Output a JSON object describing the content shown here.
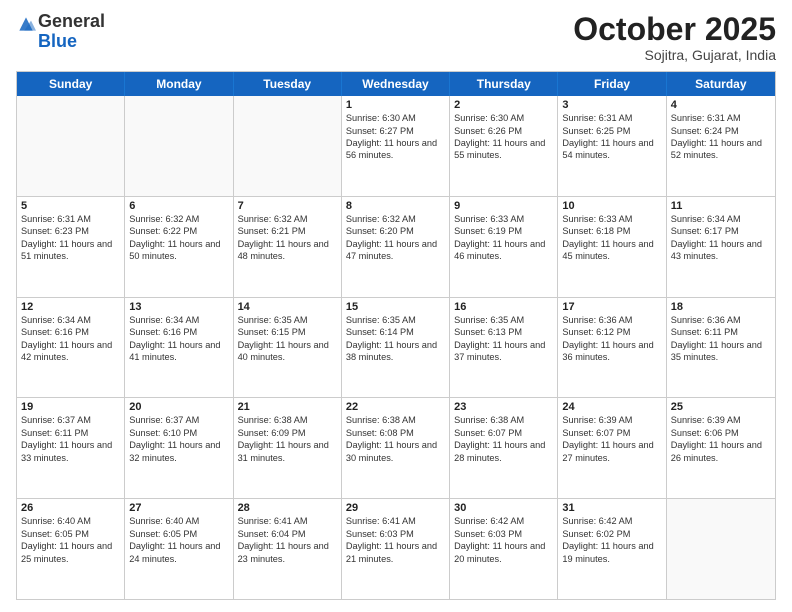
{
  "header": {
    "logo_general": "General",
    "logo_blue": "Blue",
    "month": "October 2025",
    "location": "Sojitra, Gujarat, India"
  },
  "weekdays": [
    "Sunday",
    "Monday",
    "Tuesday",
    "Wednesday",
    "Thursday",
    "Friday",
    "Saturday"
  ],
  "weeks": [
    [
      {
        "day": "",
        "sunrise": "",
        "sunset": "",
        "daylight": ""
      },
      {
        "day": "",
        "sunrise": "",
        "sunset": "",
        "daylight": ""
      },
      {
        "day": "",
        "sunrise": "",
        "sunset": "",
        "daylight": ""
      },
      {
        "day": "1",
        "sunrise": "Sunrise: 6:30 AM",
        "sunset": "Sunset: 6:27 PM",
        "daylight": "Daylight: 11 hours and 56 minutes."
      },
      {
        "day": "2",
        "sunrise": "Sunrise: 6:30 AM",
        "sunset": "Sunset: 6:26 PM",
        "daylight": "Daylight: 11 hours and 55 minutes."
      },
      {
        "day": "3",
        "sunrise": "Sunrise: 6:31 AM",
        "sunset": "Sunset: 6:25 PM",
        "daylight": "Daylight: 11 hours and 54 minutes."
      },
      {
        "day": "4",
        "sunrise": "Sunrise: 6:31 AM",
        "sunset": "Sunset: 6:24 PM",
        "daylight": "Daylight: 11 hours and 52 minutes."
      }
    ],
    [
      {
        "day": "5",
        "sunrise": "Sunrise: 6:31 AM",
        "sunset": "Sunset: 6:23 PM",
        "daylight": "Daylight: 11 hours and 51 minutes."
      },
      {
        "day": "6",
        "sunrise": "Sunrise: 6:32 AM",
        "sunset": "Sunset: 6:22 PM",
        "daylight": "Daylight: 11 hours and 50 minutes."
      },
      {
        "day": "7",
        "sunrise": "Sunrise: 6:32 AM",
        "sunset": "Sunset: 6:21 PM",
        "daylight": "Daylight: 11 hours and 48 minutes."
      },
      {
        "day": "8",
        "sunrise": "Sunrise: 6:32 AM",
        "sunset": "Sunset: 6:20 PM",
        "daylight": "Daylight: 11 hours and 47 minutes."
      },
      {
        "day": "9",
        "sunrise": "Sunrise: 6:33 AM",
        "sunset": "Sunset: 6:19 PM",
        "daylight": "Daylight: 11 hours and 46 minutes."
      },
      {
        "day": "10",
        "sunrise": "Sunrise: 6:33 AM",
        "sunset": "Sunset: 6:18 PM",
        "daylight": "Daylight: 11 hours and 45 minutes."
      },
      {
        "day": "11",
        "sunrise": "Sunrise: 6:34 AM",
        "sunset": "Sunset: 6:17 PM",
        "daylight": "Daylight: 11 hours and 43 minutes."
      }
    ],
    [
      {
        "day": "12",
        "sunrise": "Sunrise: 6:34 AM",
        "sunset": "Sunset: 6:16 PM",
        "daylight": "Daylight: 11 hours and 42 minutes."
      },
      {
        "day": "13",
        "sunrise": "Sunrise: 6:34 AM",
        "sunset": "Sunset: 6:16 PM",
        "daylight": "Daylight: 11 hours and 41 minutes."
      },
      {
        "day": "14",
        "sunrise": "Sunrise: 6:35 AM",
        "sunset": "Sunset: 6:15 PM",
        "daylight": "Daylight: 11 hours and 40 minutes."
      },
      {
        "day": "15",
        "sunrise": "Sunrise: 6:35 AM",
        "sunset": "Sunset: 6:14 PM",
        "daylight": "Daylight: 11 hours and 38 minutes."
      },
      {
        "day": "16",
        "sunrise": "Sunrise: 6:35 AM",
        "sunset": "Sunset: 6:13 PM",
        "daylight": "Daylight: 11 hours and 37 minutes."
      },
      {
        "day": "17",
        "sunrise": "Sunrise: 6:36 AM",
        "sunset": "Sunset: 6:12 PM",
        "daylight": "Daylight: 11 hours and 36 minutes."
      },
      {
        "day": "18",
        "sunrise": "Sunrise: 6:36 AM",
        "sunset": "Sunset: 6:11 PM",
        "daylight": "Daylight: 11 hours and 35 minutes."
      }
    ],
    [
      {
        "day": "19",
        "sunrise": "Sunrise: 6:37 AM",
        "sunset": "Sunset: 6:11 PM",
        "daylight": "Daylight: 11 hours and 33 minutes."
      },
      {
        "day": "20",
        "sunrise": "Sunrise: 6:37 AM",
        "sunset": "Sunset: 6:10 PM",
        "daylight": "Daylight: 11 hours and 32 minutes."
      },
      {
        "day": "21",
        "sunrise": "Sunrise: 6:38 AM",
        "sunset": "Sunset: 6:09 PM",
        "daylight": "Daylight: 11 hours and 31 minutes."
      },
      {
        "day": "22",
        "sunrise": "Sunrise: 6:38 AM",
        "sunset": "Sunset: 6:08 PM",
        "daylight": "Daylight: 11 hours and 30 minutes."
      },
      {
        "day": "23",
        "sunrise": "Sunrise: 6:38 AM",
        "sunset": "Sunset: 6:07 PM",
        "daylight": "Daylight: 11 hours and 28 minutes."
      },
      {
        "day": "24",
        "sunrise": "Sunrise: 6:39 AM",
        "sunset": "Sunset: 6:07 PM",
        "daylight": "Daylight: 11 hours and 27 minutes."
      },
      {
        "day": "25",
        "sunrise": "Sunrise: 6:39 AM",
        "sunset": "Sunset: 6:06 PM",
        "daylight": "Daylight: 11 hours and 26 minutes."
      }
    ],
    [
      {
        "day": "26",
        "sunrise": "Sunrise: 6:40 AM",
        "sunset": "Sunset: 6:05 PM",
        "daylight": "Daylight: 11 hours and 25 minutes."
      },
      {
        "day": "27",
        "sunrise": "Sunrise: 6:40 AM",
        "sunset": "Sunset: 6:05 PM",
        "daylight": "Daylight: 11 hours and 24 minutes."
      },
      {
        "day": "28",
        "sunrise": "Sunrise: 6:41 AM",
        "sunset": "Sunset: 6:04 PM",
        "daylight": "Daylight: 11 hours and 23 minutes."
      },
      {
        "day": "29",
        "sunrise": "Sunrise: 6:41 AM",
        "sunset": "Sunset: 6:03 PM",
        "daylight": "Daylight: 11 hours and 21 minutes."
      },
      {
        "day": "30",
        "sunrise": "Sunrise: 6:42 AM",
        "sunset": "Sunset: 6:03 PM",
        "daylight": "Daylight: 11 hours and 20 minutes."
      },
      {
        "day": "31",
        "sunrise": "Sunrise: 6:42 AM",
        "sunset": "Sunset: 6:02 PM",
        "daylight": "Daylight: 11 hours and 19 minutes."
      },
      {
        "day": "",
        "sunrise": "",
        "sunset": "",
        "daylight": ""
      }
    ]
  ]
}
